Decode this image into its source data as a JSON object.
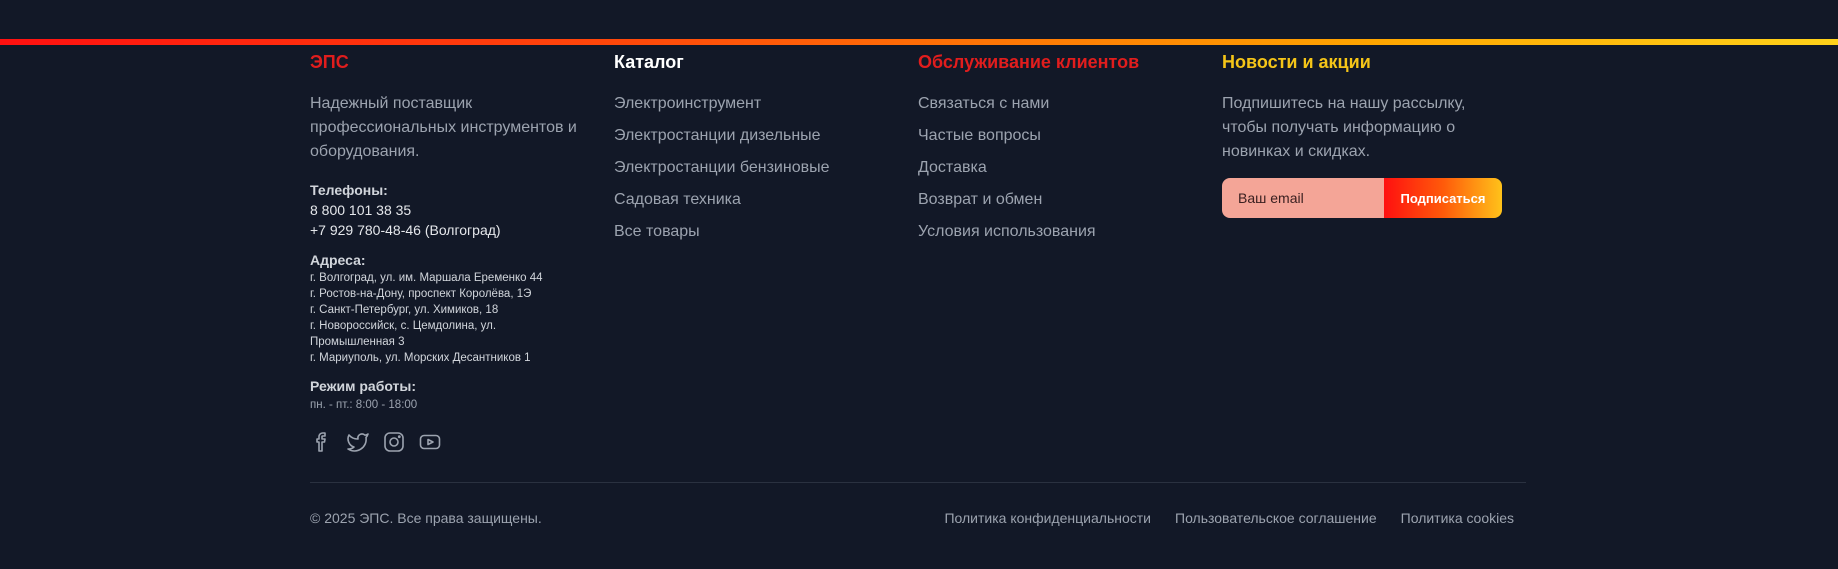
{
  "brand": {
    "title": "ЭПС",
    "description": "Надежный поставщик профессиональных инструментов и оборудования.",
    "phones_label": "Телефоны:",
    "phones": [
      "8 800 101 38 35",
      "+7 929 780-48-46 (Волгоград)"
    ],
    "addresses_label": "Адреса:",
    "addresses": [
      "г. Волгоград, ул. им. Маршала Еременко 44",
      "г. Ростов-на-Дону, проспект Королёва, 1Э",
      "г. Санкт-Петербург, ул. Химиков, 18",
      "г. Новороссийск, с. Цемдолина, ул. Промышленная 3",
      "г. Мариуполь, ул. Морских Десантников 1"
    ],
    "hours_label": "Режим работы:",
    "hours": "пн. - пт.: 8:00 - 18:00",
    "socials": [
      "facebook-icon",
      "twitter-icon",
      "instagram-icon",
      "youtube-icon"
    ]
  },
  "catalog": {
    "title": "Каталог",
    "items": [
      "Электроинструмент",
      "Электростанции дизельные",
      "Электростанции бензиновые",
      "Садовая техника",
      "Все товары"
    ]
  },
  "service": {
    "title": "Обслуживание клиентов",
    "items": [
      "Связаться с нами",
      "Частые вопросы",
      "Доставка",
      "Возврат и обмен",
      "Условия использования"
    ]
  },
  "news": {
    "title": "Новости и акции",
    "description": "Подпишитесь на нашу рассылку, чтобы получать информацию о новинках и скидках.",
    "email_placeholder": "Ваш email",
    "subscribe_label": "Подписаться"
  },
  "footer": {
    "copyright": "© 2025 ЭПС. Все права защищены.",
    "links": [
      "Политика конфиденциальности",
      "Пользовательское соглашение",
      "Политика cookies"
    ]
  },
  "colors": {
    "background": "#121827",
    "accent_red": "#e11d1d",
    "accent_yellow": "#f5c518"
  }
}
